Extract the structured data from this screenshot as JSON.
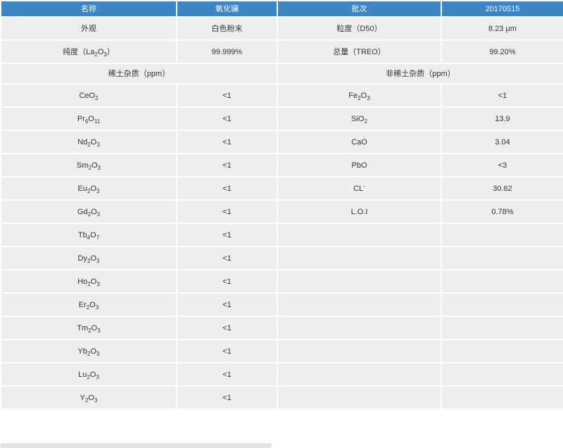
{
  "header": {
    "c1": "名称",
    "c2": "氧化镧",
    "c3": "批次",
    "c4": "20170515"
  },
  "info": [
    {
      "label_a": "外观",
      "value_a": "白色粉末",
      "label_b": "粒度（D50）",
      "value_b": "8.23 μm"
    },
    {
      "label_a_prefix": "纯度（La",
      "label_a_sub1": "2",
      "label_a_mid": "O",
      "label_a_sub2": "3",
      "label_a_suffix": "）",
      "value_a": "99.999%",
      "label_b": "总量（TREO）",
      "value_b": "99.20%"
    }
  ],
  "categories": {
    "rare_earth": "稀土杂质（ppm）",
    "non_rare_earth": "非稀土杂质（ppm）"
  },
  "rare_earth": [
    {
      "el": "Ce",
      "s1": "",
      "o": "O",
      "s2": "2",
      "value": "<1"
    },
    {
      "el": "Pr",
      "s1": "6",
      "o": "O",
      "s2": "11",
      "value": "<1"
    },
    {
      "el": "Nd",
      "s1": "2",
      "o": "O",
      "s2": "3",
      "value": "<1"
    },
    {
      "el": "Sm",
      "s1": "2",
      "o": "O",
      "s2": "3",
      "value": "<1"
    },
    {
      "el": "Eu",
      "s1": "2",
      "o": "O",
      "s2": "3",
      "value": "<1"
    },
    {
      "el": "Gd",
      "s1": "2",
      "o": "O",
      "s2": "3",
      "value": "<1"
    },
    {
      "el": "Tb",
      "s1": "4",
      "o": "O",
      "s2": "7",
      "value": "<1"
    },
    {
      "el": "Dy",
      "s1": "2",
      "o": "O",
      "s2": "3",
      "value": "<1"
    },
    {
      "el": "Ho",
      "s1": "2",
      "o": "O",
      "s2": "3",
      "value": "<1"
    },
    {
      "el": "Er",
      "s1": "2",
      "o": "O",
      "s2": "3",
      "value": "<1"
    },
    {
      "el": "Tm",
      "s1": "2",
      "o": "O",
      "s2": "3",
      "value": "<1"
    },
    {
      "el": "Yb",
      "s1": "2",
      "o": "O",
      "s2": "3",
      "value": "<1"
    },
    {
      "el": "Lu",
      "s1": "2",
      "o": "O",
      "s2": "3",
      "value": "<1"
    },
    {
      "el": "Y",
      "s1": "2",
      "o": "O",
      "s2": "3",
      "value": "<1"
    }
  ],
  "non_rare_earth": [
    {
      "el": "Fe",
      "s1": "2",
      "o": "O",
      "s2": "3",
      "sup": "",
      "value": "<1"
    },
    {
      "el": "Si",
      "s1": "",
      "o": "O",
      "s2": "2",
      "sup": "",
      "value": "13.9"
    },
    {
      "el": "CaO",
      "s1": "",
      "o": "",
      "s2": "",
      "sup": "",
      "value": "3.04"
    },
    {
      "el": "PbO",
      "s1": "",
      "o": "",
      "s2": "",
      "sup": "",
      "value": "<3"
    },
    {
      "el": "CL",
      "s1": "",
      "o": "",
      "s2": "",
      "sup": "-",
      "value": "30.62"
    },
    {
      "el": "L.O.I",
      "s1": "",
      "o": "",
      "s2": "",
      "sup": "",
      "value": "0.78%"
    }
  ],
  "colors": {
    "header_bg": "#3d86c6",
    "cell_bg": "#eeeeee",
    "text": "#333333"
  }
}
